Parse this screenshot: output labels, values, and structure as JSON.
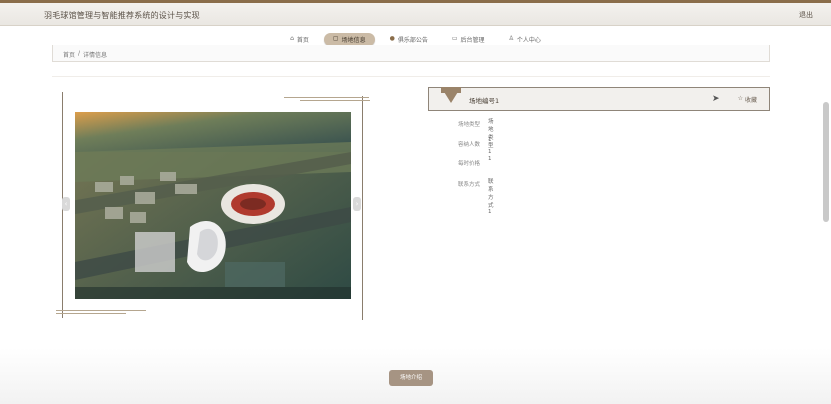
{
  "app": {
    "title": "羽毛球馆管理与智能推荐系统的设计与实现",
    "logout_label": "退出"
  },
  "nav": {
    "items": [
      {
        "label": "首页",
        "icon": "home-icon",
        "glyph": "⌂"
      },
      {
        "label": "场地信息",
        "icon": "field-icon",
        "glyph": "▢"
      },
      {
        "label": "俱乐部公告",
        "icon": "notice-icon",
        "glyph": "●"
      },
      {
        "label": "后台管理",
        "icon": "admin-icon",
        "glyph": "▭"
      },
      {
        "label": "个人中心",
        "icon": "user-icon",
        "glyph": "♙"
      }
    ],
    "active_index": 1
  },
  "breadcrumb": {
    "home": "首页",
    "separator": "/",
    "current": "详情信息"
  },
  "detail": {
    "title": "场地编号1",
    "favorite_label": "收藏",
    "favorite_icon": "star-icon",
    "fields": [
      {
        "label": "场地类型",
        "value": "场地类型1"
      },
      {
        "label": "容纳人数",
        "value": "1"
      },
      {
        "label": "每时价格",
        "value": "1"
      },
      {
        "label": "联系方式",
        "value": "联系方式1"
      }
    ]
  },
  "gallery": {
    "prev_glyph": "‹",
    "next_glyph": "›"
  },
  "footer": {
    "intro_button_label": "场地介绍"
  },
  "colors": {
    "accent": "#9a8369",
    "active_nav": "#cbbba6",
    "button": "#a69483"
  }
}
